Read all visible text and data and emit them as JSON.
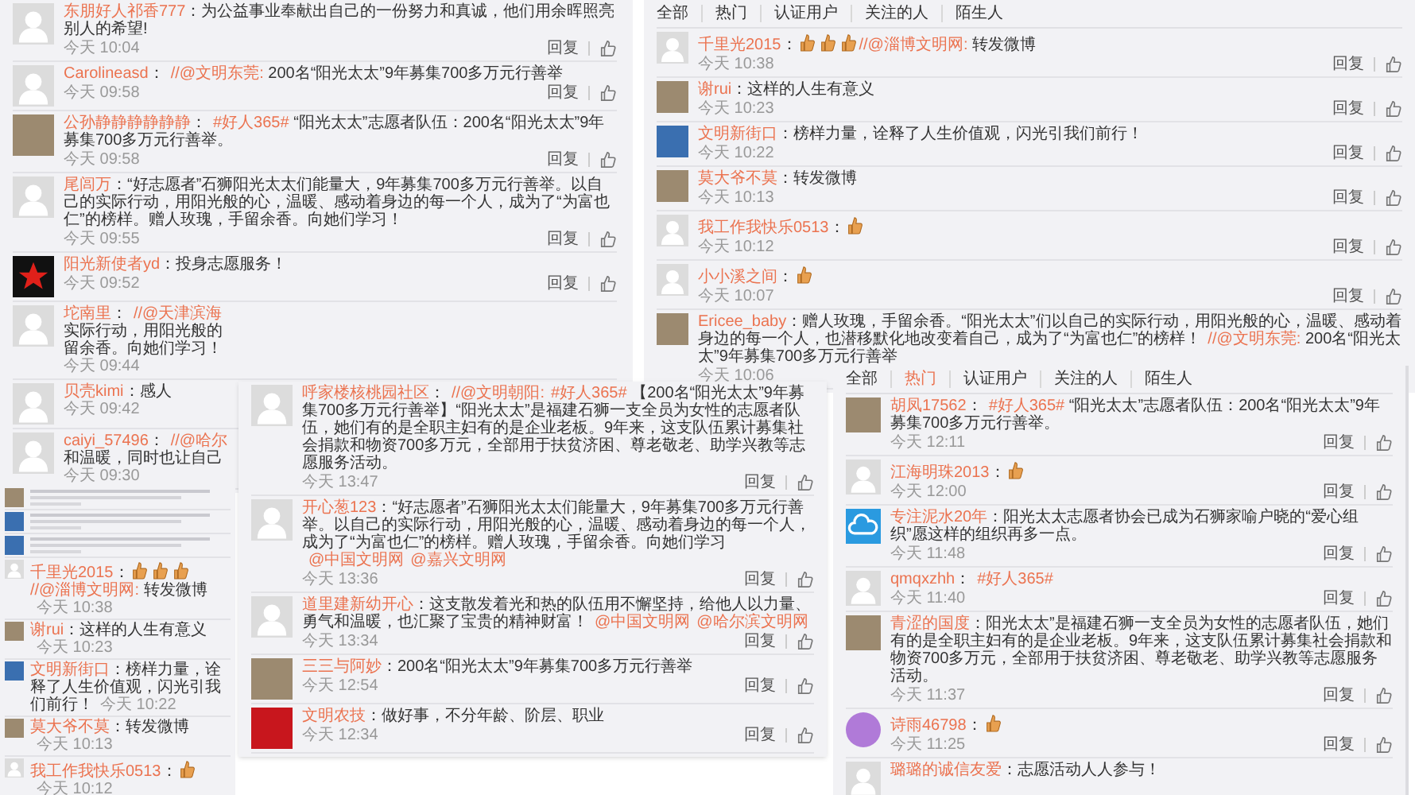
{
  "panels": [
    {
      "comments": [
        {
          "kind": "normal",
          "avatar": {
            "kind": "default"
          },
          "user": "东朋好人祁香777",
          "body": [
            {
              "kind": "text",
              "text": "：为公益事业奉献出自己的一份努力和真诚，他们用余晖照亮别人的希望!"
            }
          ],
          "time": "今天 10:04",
          "reply": "回复"
        },
        {
          "kind": "normal",
          "avatar": {
            "kind": "default"
          },
          "user": "Carolineasd",
          "body": [
            {
              "kind": "text",
              "text": "："
            },
            {
              "kind": "link",
              "text": "//@文明东莞:"
            },
            {
              "kind": "text",
              "text": " 200名“阳光太太”9年募集700多万元行善举"
            }
          ],
          "time": "今天 09:58",
          "reply": "回复"
        },
        {
          "kind": "normal",
          "avatar": {
            "kind": "photo"
          },
          "user": "公孙静静静静静静",
          "body": [
            {
              "kind": "text",
              "text": "："
            },
            {
              "kind": "link",
              "text": "#好人365#"
            },
            {
              "kind": "text",
              "text": " “阳光太太”志愿者队伍：200名“阳光太太”9年募集700多万元行善举。"
            }
          ],
          "time": "今天 09:58",
          "reply": "回复"
        },
        {
          "kind": "normal",
          "avatar": {
            "kind": "default"
          },
          "user": "尾闾万",
          "body": [
            {
              "kind": "text",
              "text": "：“好志愿者”石狮阳光太太们能量大，9年募集700多万元行善举。以自己的实际行动，用阳光般的心，温暖、感动着身边的每一个人，成为了“为富也仁”的榜样。赠人玫瑰，手留余香。向她们学习！"
            }
          ],
          "time": "今天 09:55",
          "reply": "回复"
        },
        {
          "kind": "normal",
          "avatar": {
            "kind": "star"
          },
          "user": "阳光新使者yd",
          "body": [
            {
              "kind": "text",
              "text": "：投身志愿服务！"
            }
          ],
          "time": "今天 09:52",
          "reply": "回复"
        },
        {
          "kind": "clipped",
          "avatar": {
            "kind": "default"
          },
          "user": "坨南里",
          "lines": [
            [
              {
                "kind": "text",
                "text": "："
              },
              {
                "kind": "link",
                "text": "//@天津滨海"
              }
            ],
            [
              {
                "kind": "text",
                "text": "实际行动，用阳光般的"
              }
            ],
            [
              {
                "kind": "text",
                "text": "留余香。向她们学习！"
              }
            ]
          ],
          "time": "今天 09:44"
        },
        {
          "kind": "clipped",
          "avatar": {
            "kind": "default"
          },
          "user": "贝壳kimi",
          "lines": [
            [
              {
                "kind": "text",
                "text": "：感人"
              }
            ]
          ],
          "time": "今天 09:42"
        },
        {
          "kind": "clipped",
          "avatar": {
            "kind": "default"
          },
          "user": "caiyi_57496",
          "lines": [
            [
              {
                "kind": "text",
                "text": "："
              },
              {
                "kind": "link",
                "text": "//@哈尔"
              }
            ],
            [
              {
                "kind": "text",
                "text": "和温暖，同时也让自己"
              }
            ]
          ],
          "time": "今天 09:30"
        }
      ]
    },
    {
      "tabs": [
        {
          "label": "全部",
          "selected": false
        },
        {
          "label": "热门",
          "selected": false
        },
        {
          "label": "认证用户",
          "selected": false
        },
        {
          "label": "关注的人",
          "selected": false
        },
        {
          "label": "陌生人",
          "selected": false
        }
      ],
      "comments": [
        {
          "kind": "normal",
          "avatar": {
            "kind": "default"
          },
          "user": "千里光2015",
          "body": [
            {
              "kind": "text",
              "text": "："
            },
            {
              "kind": "thumb"
            },
            {
              "kind": "thumb"
            },
            {
              "kind": "thumb"
            },
            {
              "kind": "link",
              "text": "//@淄博文明网:"
            },
            {
              "kind": "text",
              "text": " 转发微博"
            }
          ],
          "time": "今天 10:38",
          "reply": "回复"
        },
        {
          "kind": "normal",
          "avatar": {
            "kind": "photo"
          },
          "user": "谢rui",
          "body": [
            {
              "kind": "text",
              "text": "：这样的人生有意义"
            }
          ],
          "time": "今天 10:23",
          "reply": "回复"
        },
        {
          "kind": "normal",
          "avatar": {
            "kind": "sky"
          },
          "user": "文明新街口",
          "body": [
            {
              "kind": "text",
              "text": "：榜样力量，诠释了人生价值观，闪光引我们前行！"
            }
          ],
          "time": "今天 10:22",
          "reply": "回复"
        },
        {
          "kind": "normal",
          "avatar": {
            "kind": "photo"
          },
          "user": "莫大爷不莫",
          "body": [
            {
              "kind": "text",
              "text": "：转发微博"
            }
          ],
          "time": "今天 10:13",
          "reply": "回复"
        },
        {
          "kind": "normal",
          "avatar": {
            "kind": "default"
          },
          "user": "我工作我快乐0513",
          "body": [
            {
              "kind": "text",
              "text": "："
            },
            {
              "kind": "thumb"
            }
          ],
          "time": "今天 10:12",
          "reply": "回复"
        },
        {
          "kind": "normal",
          "avatar": {
            "kind": "default"
          },
          "user": "小小溪之间",
          "body": [
            {
              "kind": "text",
              "text": "："
            },
            {
              "kind": "thumb"
            }
          ],
          "time": "今天 10:07",
          "reply": "回复"
        },
        {
          "kind": "normal",
          "avatar": {
            "kind": "photo"
          },
          "user": "Ericee_baby",
          "body": [
            {
              "kind": "text",
              "text": "：赠人玫瑰，手留余香。“阳光太太”们以自己的实际行动，用阳光般的心，温暖、感动着身边的每一个人，也潜移默化地改变着自己，成为了“为富也仁”的榜样！"
            },
            {
              "kind": "link",
              "text": "//@文明东莞:"
            },
            {
              "kind": "text",
              "text": " 200名“阳光太太”9年募集700多万元行善举"
            }
          ],
          "time": "今天 10:06"
        }
      ]
    },
    {
      "comments": [
        {
          "kind": "blurred",
          "avatar": {
            "kind": "photo"
          }
        },
        {
          "kind": "blurred",
          "avatar": {
            "kind": "sky"
          }
        },
        {
          "kind": "blurred",
          "avatar": {
            "kind": "sky"
          }
        },
        {
          "kind": "normal",
          "avatar": {
            "kind": "default"
          },
          "user": "千里光2015",
          "body": [
            {
              "kind": "text",
              "text": "："
            },
            {
              "kind": "thumb"
            },
            {
              "kind": "thumb"
            },
            {
              "kind": "thumb"
            },
            {
              "kind": "link",
              "text": "//@淄博文明网:"
            },
            {
              "kind": "text",
              "text": " 转发微博"
            }
          ],
          "time": "今天 10:38"
        },
        {
          "kind": "normal",
          "avatar": {
            "kind": "photo"
          },
          "user": "谢rui",
          "body": [
            {
              "kind": "text",
              "text": "：这样的人生有意义"
            }
          ],
          "time": "今天 10:23"
        },
        {
          "kind": "normal",
          "avatar": {
            "kind": "sky"
          },
          "user": "文明新街口",
          "body": [
            {
              "kind": "text",
              "text": "：榜样力量，诠释了人生价值观，闪光引我们前行！"
            }
          ],
          "time": "今天 10:22"
        },
        {
          "kind": "normal",
          "avatar": {
            "kind": "photo"
          },
          "user": "莫大爷不莫",
          "body": [
            {
              "kind": "text",
              "text": "：转发微博"
            }
          ],
          "time": "今天 10:13"
        },
        {
          "kind": "normal",
          "avatar": {
            "kind": "default"
          },
          "user": "我工作我快乐0513",
          "body": [
            {
              "kind": "text",
              "text": "："
            },
            {
              "kind": "thumb"
            }
          ],
          "time": "今天 10:12"
        }
      ]
    },
    {
      "comments": [
        {
          "kind": "normal",
          "avatar": {
            "kind": "default"
          },
          "user": "呼家楼核桃园社区",
          "body": [
            {
              "kind": "text",
              "text": "："
            },
            {
              "kind": "link",
              "text": "//@文明朝阳:"
            },
            {
              "kind": "link",
              "text": "#好人365#"
            },
            {
              "kind": "text",
              "text": " 【200名“阳光太太”9年募集700多万元行善举】“阳光太太”是福建石狮一支全员为女性的志愿者队伍，她们有的是全职主妇有的是企业老板。9年来，这支队伍累计募集社会捐款和物资700多万元，全部用于扶贫济困、尊老敬老、助学兴教等志愿服务活动。"
            }
          ],
          "time": "今天 13:47",
          "reply": "回复"
        },
        {
          "kind": "normal",
          "avatar": {
            "kind": "default"
          },
          "user": "开心葱123",
          "body": [
            {
              "kind": "text",
              "text": "：“好志愿者”石狮阳光太太们能量大，9年募集700多万元行善举。以自己的实际行动，用阳光般的心，温暖、感动着身边的每一个人，成为了“为富也仁”的榜样。赠人玫瑰，手留余香。向她们学习"
            },
            {
              "kind": "link",
              "text": "@中国文明网"
            },
            {
              "kind": "link",
              "text": "@嘉兴文明网"
            }
          ],
          "time": "今天 13:36",
          "reply": "回复"
        },
        {
          "kind": "normal",
          "avatar": {
            "kind": "default"
          },
          "user": "道里建新幼开心",
          "body": [
            {
              "kind": "text",
              "text": "：这支散发着光和热的队伍用不懈坚持，给他人以力量、勇气和温暖，也汇聚了宝贵的精神财富！"
            },
            {
              "kind": "link",
              "text": "@中国文明网"
            },
            {
              "kind": "link",
              "text": "@哈尔滨文明网"
            }
          ],
          "time": "今天 13:34",
          "reply": "回复"
        },
        {
          "kind": "normal",
          "avatar": {
            "kind": "photo"
          },
          "user": "三三与阿妙",
          "body": [
            {
              "kind": "text",
              "text": "：200名“阳光太太”9年募集700多万元行善举"
            }
          ],
          "time": "今天 12:54",
          "reply": "回复"
        },
        {
          "kind": "normal",
          "avatar": {
            "kind": "red"
          },
          "user": "文明农技",
          "body": [
            {
              "kind": "text",
              "text": "：做好事，不分年龄、阶层、职业"
            }
          ],
          "time": "今天 12:34",
          "reply": "回复"
        }
      ]
    },
    {
      "tabs": [
        {
          "label": "全部",
          "selected": false
        },
        {
          "label": "热门",
          "selected": true
        },
        {
          "label": "认证用户",
          "selected": false
        },
        {
          "label": "关注的人",
          "selected": false
        },
        {
          "label": "陌生人",
          "selected": false
        }
      ],
      "comments": [
        {
          "kind": "normal",
          "avatar": {
            "kind": "photo"
          },
          "user": "胡凤17562",
          "body": [
            {
              "kind": "text",
              "text": "："
            },
            {
              "kind": "link",
              "text": "#好人365#"
            },
            {
              "kind": "text",
              "text": " “阳光太太”志愿者队伍：200名“阳光太太”9年募集700多万元行善举。"
            }
          ],
          "time": "今天 12:11",
          "reply": "回复"
        },
        {
          "kind": "normal",
          "avatar": {
            "kind": "default"
          },
          "user": "江海明珠2013",
          "body": [
            {
              "kind": "text",
              "text": "："
            },
            {
              "kind": "thumb"
            }
          ],
          "time": "今天 12:00",
          "reply": "回复"
        },
        {
          "kind": "normal",
          "avatar": {
            "kind": "cloud"
          },
          "user": "专注泥水20年",
          "body": [
            {
              "kind": "text",
              "text": "：阳光太太志愿者协会已成为石狮家喻户晓的“爱心组织”愿这样的组织再多一点。"
            }
          ],
          "time": "今天 11:48",
          "reply": "回复"
        },
        {
          "kind": "normal",
          "avatar": {
            "kind": "default"
          },
          "user": "qmqxzhh",
          "body": [
            {
              "kind": "text",
              "text": "："
            },
            {
              "kind": "link",
              "text": "#好人365#"
            }
          ],
          "time": "今天 11:40",
          "reply": "回复"
        },
        {
          "kind": "normal",
          "avatar": {
            "kind": "photo"
          },
          "user": "青涩的国度",
          "body": [
            {
              "kind": "text",
              "text": "：阳光太太”是福建石狮一支全员为女性的志愿者队伍，她们有的是全职主妇有的是企业老板。9年来，这支队伍累计募集社会捐款和物资700多万元，全部用于扶贫济困、尊老敬老、助学兴教等志愿服务活动。"
            }
          ],
          "time": "今天 11:37",
          "reply": "回复"
        },
        {
          "kind": "normal",
          "avatar": {
            "kind": "cartoon"
          },
          "user": "诗雨46798",
          "body": [
            {
              "kind": "text",
              "text": "："
            },
            {
              "kind": "thumb"
            }
          ],
          "time": "今天 11:25",
          "reply": "回复"
        },
        {
          "kind": "normal",
          "avatar": {
            "kind": "default"
          },
          "user": "璐璐的诚信友爱",
          "body": [
            {
              "kind": "text",
              "text": "：志愿活动人人参与！"
            }
          ]
        }
      ]
    }
  ]
}
